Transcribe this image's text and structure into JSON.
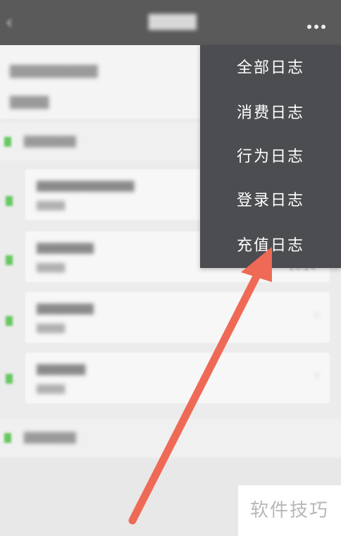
{
  "menu": {
    "items": [
      {
        "label": "全部日志"
      },
      {
        "label": "消费日志"
      },
      {
        "label": "行为日志"
      },
      {
        "label": "登录日志"
      },
      {
        "label": "充值日志"
      }
    ]
  },
  "background": {
    "time_label": "20:24"
  },
  "watermark": "软件技巧",
  "colors": {
    "menu_bg": "#4b4d50",
    "arrow": "#ef6a56",
    "accent_green": "#65c860"
  }
}
